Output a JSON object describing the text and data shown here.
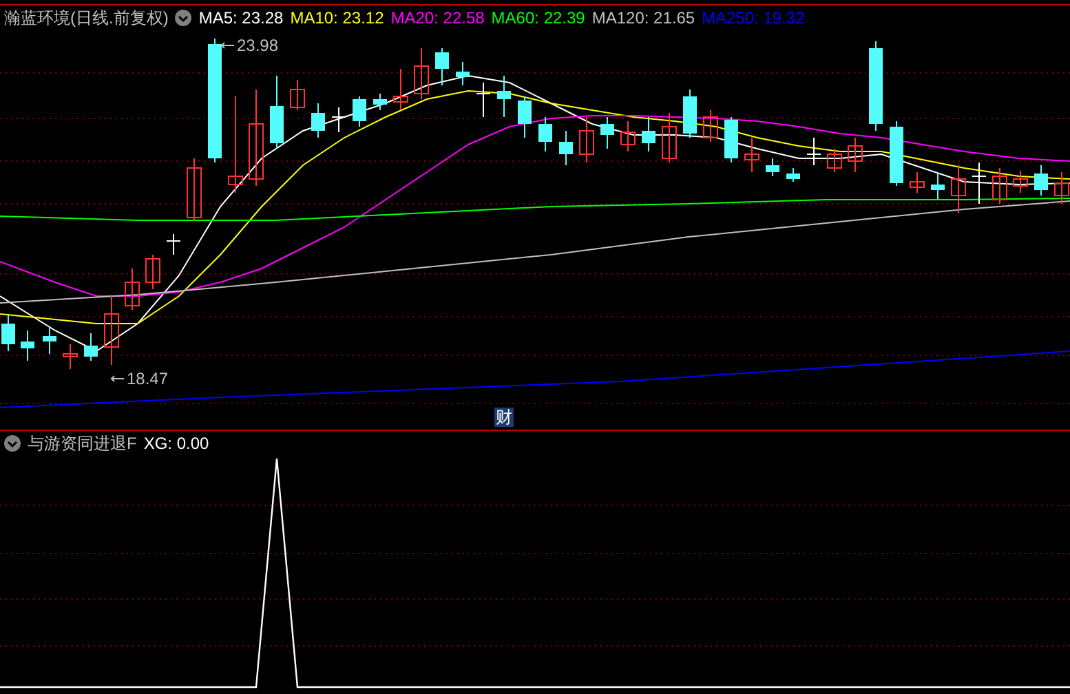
{
  "main_panel": {
    "title": "瀚蓝环境(日线.前复权)",
    "indicators": [
      {
        "label": "MA5: 23.28",
        "color": "#ffffff"
      },
      {
        "label": "MA10: 23.12",
        "color": "#ffff00"
      },
      {
        "label": "MA20: 22.58",
        "color": "#ff00ff"
      },
      {
        "label": "MA60: 22.39",
        "color": "#00ff00"
      },
      {
        "label": "MA120: 21.65",
        "color": "#c0c0c0"
      },
      {
        "label": "MA250: 19.32",
        "color": "#0000ff"
      }
    ],
    "high_marker": "23.98",
    "low_marker": "18.47",
    "finance_badge": "财"
  },
  "sub_panel": {
    "title": "与游资同进退F",
    "reading": "XG: 0.00"
  }
}
